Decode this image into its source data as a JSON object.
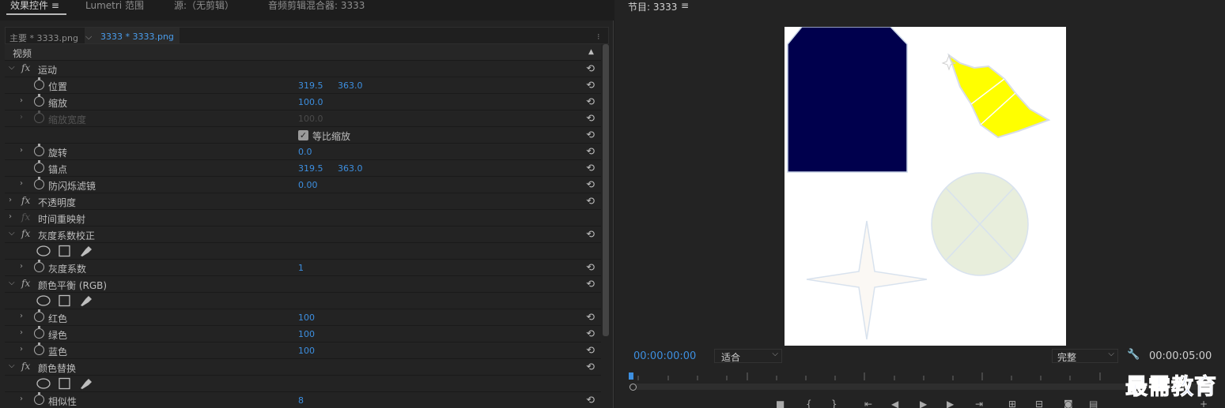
{
  "tabs": [
    {
      "label": "效果控件",
      "active": true
    },
    {
      "label": "Lumetri 范围",
      "active": false
    },
    {
      "label": "源:（无剪辑）",
      "active": false
    },
    {
      "label": "音频剪辑混合器: 3333",
      "active": false
    }
  ],
  "tab_menu_icon": "≡",
  "sub": {
    "master": "主要 * 3333.png",
    "seq": "3333 * 3333.png"
  },
  "video_header": "视频",
  "rows": {
    "motion": "运动",
    "position": "位置",
    "position_x": "319.5",
    "position_y": "363.0",
    "scale": "缩放",
    "scale_val": "100.0",
    "scale_w": "缩放宽度",
    "scale_w_val": "100.0",
    "uniform": "等比缩放",
    "rotation": "旋转",
    "rotation_val": "0.0",
    "anchor": "锚点",
    "anchor_x": "319.5",
    "anchor_y": "363.0",
    "flicker": "防闪烁滤镜",
    "flicker_val": "0.00",
    "opacity": "不透明度",
    "remap": "时间重映射",
    "gamma_fx": "灰度系数校正",
    "gamma": "灰度系数",
    "gamma_val": "1",
    "cb_fx": "颜色平衡 (RGB)",
    "red": "红色",
    "red_val": "100",
    "green": "绿色",
    "green_val": "100",
    "blue": "蓝色",
    "blue_val": "100",
    "cr_fx": "颜色替换",
    "sim": "相似性",
    "sim_val": "8"
  },
  "program": {
    "title": "节目: 3333",
    "menu": "≡",
    "timecode": "00:00:00:00",
    "fit": "适合",
    "full": "完整",
    "duration": "00:00:05:00"
  },
  "colors": {
    "accent": "#3d8fe0",
    "navy_shape": "#00004d",
    "yellow_shape": "#ffff00",
    "circle_shape": "#e8eedc"
  },
  "watermark": "最需教育"
}
